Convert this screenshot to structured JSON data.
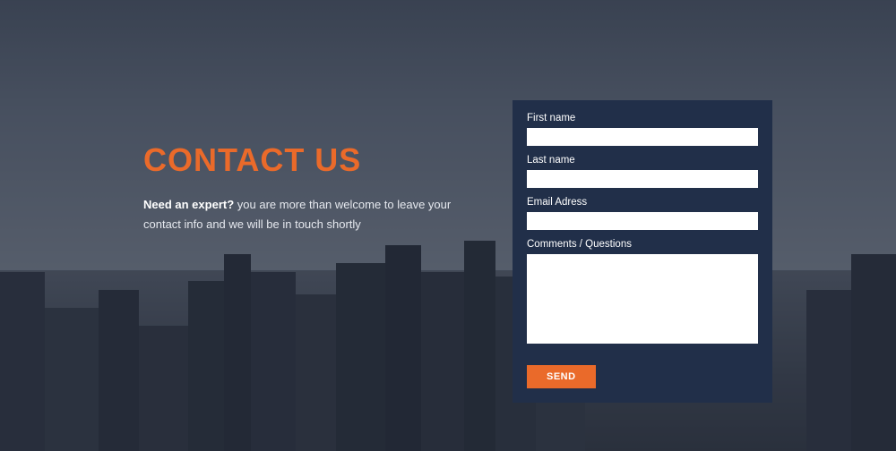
{
  "heading": "CONTACT US",
  "subtext": {
    "bold": "Need an expert?",
    "rest": " you are more than welcome to leave your contact info and we will be in touch shortly"
  },
  "form": {
    "fields": {
      "first_name": {
        "label": "First name",
        "value": ""
      },
      "last_name": {
        "label": "Last name",
        "value": ""
      },
      "email": {
        "label": "Email Adress",
        "value": ""
      },
      "comments": {
        "label": "Comments / Questions",
        "value": ""
      }
    },
    "submit_label": "SEND"
  },
  "colors": {
    "accent": "#ea6a2a",
    "panel": "#212f49"
  }
}
